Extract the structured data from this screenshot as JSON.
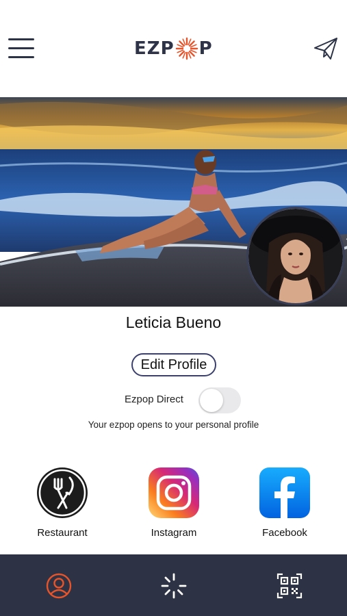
{
  "header": {
    "logo_left": "EZP",
    "logo_right": "P",
    "menu_icon": "hamburger-menu-icon",
    "send_icon": "paper-plane-icon"
  },
  "profile": {
    "name": "Leticia Bueno",
    "edit_button_label": "Edit Profile"
  },
  "ezpop_direct": {
    "label": "Ezpop Direct",
    "enabled": false,
    "description": "Your ezpop opens to your personal profile"
  },
  "links": [
    {
      "label": "Restaurant",
      "icon": "fork-knife-icon"
    },
    {
      "label": "Instagram",
      "icon": "instagram-icon"
    },
    {
      "label": "Facebook",
      "icon": "facebook-icon"
    }
  ],
  "tabbar": {
    "items": [
      {
        "icon": "user-icon",
        "active": true
      },
      {
        "icon": "loading-spinner-icon",
        "active": false
      },
      {
        "icon": "qr-code-icon",
        "active": false
      }
    ]
  },
  "colors": {
    "navy": "#2d3345",
    "accent_orange": "#e8542a",
    "toggle_off": "#e9e9eb",
    "facebook_blue": "#1877f2"
  }
}
